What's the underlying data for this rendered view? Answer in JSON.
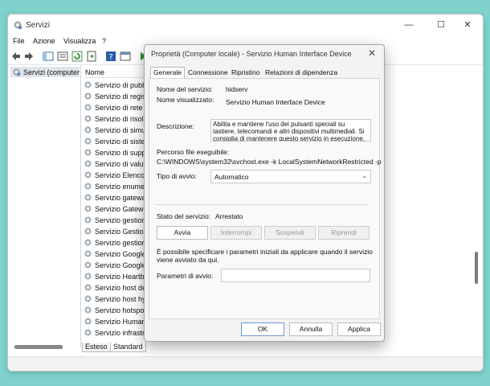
{
  "window": {
    "title": "Servizi",
    "minimize_glyph": "—",
    "maximize_glyph": "☐",
    "close_glyph": "✕"
  },
  "menu": [
    {
      "label": "File"
    },
    {
      "label": "Azione"
    },
    {
      "label": "Visualizza"
    },
    {
      "label": "?"
    }
  ],
  "tree": {
    "root_label": "Servizi (computer l"
  },
  "list": {
    "column_name": "Nome",
    "rows": [
      "Servizio di pubbl",
      "Servizio di regist",
      "Servizio di rete X",
      "Servizio di risolu",
      "Servizio di simul",
      "Servizio di sisten",
      "Servizio di suppo",
      "Servizio di valuta",
      "Servizio Elenco r",
      "Servizio enumer",
      "Servizio gateway",
      "Servizio Gateway",
      "Servizio gestione",
      "Servizio Gestione",
      "Servizio gestione",
      "Servizio Google",
      "Servizio Google",
      "Servizio Heartbe",
      "Servizio host del",
      "Servizio host hy",
      "Servizio hotspot",
      "Servizio Human",
      "Servizio infrastr"
    ]
  },
  "bottom_tabs": [
    {
      "label": "Esteso"
    },
    {
      "label": "Standard"
    }
  ],
  "dialog": {
    "title": "Proprietà (Computer locale) - Servizio Human Interface Device",
    "close_glyph": "✕",
    "tabs": [
      {
        "label": "Generale",
        "active": true
      },
      {
        "label": "Connessione",
        "active": false
      },
      {
        "label": "Ripristino",
        "active": false
      },
      {
        "label": "Relazioni di dipendenza",
        "active": false
      }
    ],
    "service_name_label": "Nome del servizio:",
    "service_name_value": "hidserv",
    "display_name_label": "Nome visualizzato:",
    "display_name_value": "Servizio Human Interface Device",
    "description_label": "Descrizione:",
    "description_value": "Abilita e mantiene l'uso dei pulsanti speciali su tastiere, telecomandi e altri dispositivi multimediali. Si consiglia di mantenere questo servizio in esecuzione.",
    "exe_path_label": "Percorso file eseguibile:",
    "exe_path_value": "C:\\WINDOWS\\system32\\svchost.exe -k LocalSystemNetworkRestricted -p",
    "startup_type_label": "Tipo di avvio:",
    "startup_type_value": "Automatico",
    "status_label": "Stato del servizio:",
    "status_value": "Arrestato",
    "buttons": {
      "start": "Avvia",
      "stop": "Interrompi",
      "pause": "Sospendi",
      "resume": "Riprendi"
    },
    "note": "È possibile specificare i parametri iniziali da applicare quando il servizio viene avviato da qui.",
    "params_label": "Parametri di avvio:",
    "params_value": "",
    "ok": "OK",
    "cancel": "Annulla",
    "apply": "Applica"
  },
  "colors": {
    "desktop": "#7fd3cc",
    "accent": "#6a9bd3"
  }
}
